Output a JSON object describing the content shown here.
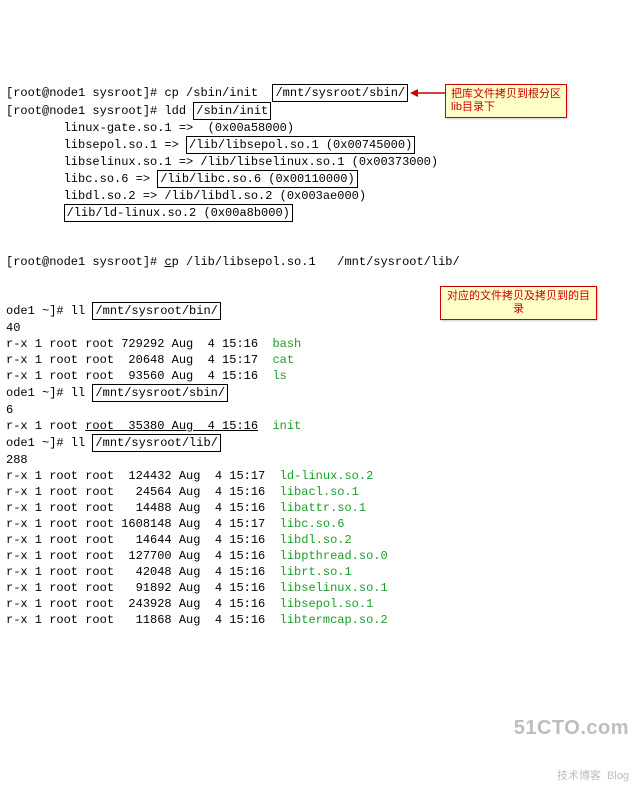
{
  "line1": {
    "prompt": "[root@node1 sysroot]#",
    "cmd": "cp /sbin/init",
    "box": "/mnt/sysroot/sbin/"
  },
  "ldd": {
    "prompt": "[root@node1 sysroot]#",
    "cmd": "ldd ",
    "box": "/sbin/init",
    "l1": "        linux-gate.so.1 =>  (0x00a58000)",
    "l2a": "        libsepol.so.1 =>",
    "l2b": "/lib/libsepol.so.1 (0x00745000)",
    "l3": "        libselinux.so.1 => /lib/libselinux.so.1 (0x00373000)",
    "l4a": "        libc.so.6 =>",
    "l4b": "/lib/libc.so.6 (0x00110000)",
    "l5": "        libdl.so.2 => /lib/libdl.so.2 (0x003ae000)",
    "l6a": "       ",
    "l6b": "/lib/ld-linux.so.2 (0x00a8b000)"
  },
  "cp2": {
    "prompt": "[root@node1 sysroot]#",
    "c": "c",
    "rest": "p /lib/libsepol.so.1   /mnt/sysroot/lib/"
  },
  "bin": {
    "prompt": "ode1 ~]# ll",
    "box": "/mnt/sysroot/bin/",
    "total": "40",
    "rows": [
      {
        "p": "r-x 1 root root 729292 Aug  4 15:16",
        "n": "bash"
      },
      {
        "p": "r-x 1 root root  20648 Aug  4 15:17",
        "n": "cat"
      },
      {
        "p": "r-x 1 root root  93560 Aug  4 15:16",
        "n": "ls"
      }
    ]
  },
  "sbin": {
    "prompt": "ode1 ~]# ll",
    "box": "/mnt/sysroot/sbin/",
    "total": "6",
    "row": {
      "p": "r-x 1 root",
      "u": "root  35380 Aug  4 15:16",
      "n": "init"
    }
  },
  "lib": {
    "prompt": "ode1 ~]# ll",
    "box": "/mnt/sysroot/lib/",
    "total": "288",
    "rows": [
      {
        "p": "r-x 1 root root  124432 Aug  4 15:17",
        "n": "ld-linux.so.2"
      },
      {
        "p": "r-x 1 root root   24564 Aug  4 15:16",
        "n": "libacl.so.1"
      },
      {
        "p": "r-x 1 root root   14488 Aug  4 15:16",
        "n": "libattr.so.1"
      },
      {
        "p": "r-x 1 root root 1608148 Aug  4 15:17",
        "n": "libc.so.6"
      },
      {
        "p": "r-x 1 root root   14644 Aug  4 15:16",
        "n": "libdl.so.2"
      },
      {
        "p": "r-x 1 root root  127700 Aug  4 15:16",
        "n": "libpthread.so.0"
      },
      {
        "p": "r-x 1 root root   42048 Aug  4 15:16",
        "n": "librt.so.1"
      },
      {
        "p": "r-x 1 root root   91892 Aug  4 15:16",
        "n": "libselinux.so.1"
      },
      {
        "p": "r-x 1 root root  243928 Aug  4 15:16",
        "n": "libsepol.so.1"
      },
      {
        "p": "r-x 1 root root   11868 Aug  4 15:16",
        "n": "libtermcap.so.2"
      }
    ]
  },
  "annot1": "把库文件拷贝到根分区lib目录下",
  "annot2": "对应的文件拷贝及拷贝到的目录",
  "watermark": {
    "big": "51CTO.com",
    "small": "技术博客  Blog"
  }
}
